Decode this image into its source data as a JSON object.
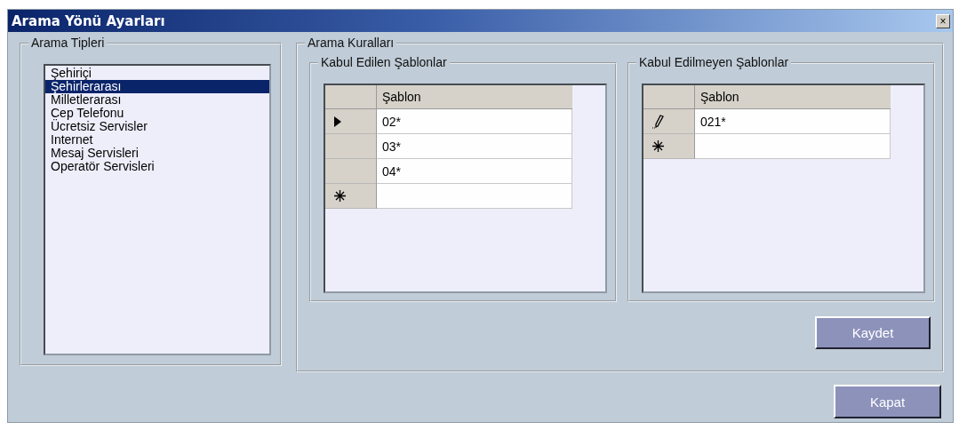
{
  "window": {
    "title": "Arama Yönü Ayarları",
    "close": "×"
  },
  "call_types": {
    "title": "Arama Tipleri",
    "items": [
      {
        "label": "Şehiriçi",
        "selected": false
      },
      {
        "label": "Şehirlerarası",
        "selected": true
      },
      {
        "label": "Milletlerarası",
        "selected": false
      },
      {
        "label": "Cep Telefonu",
        "selected": false
      },
      {
        "label": "Ücretsiz Servisler",
        "selected": false
      },
      {
        "label": "Internet",
        "selected": false
      },
      {
        "label": "Mesaj Servisleri",
        "selected": false
      },
      {
        "label": "Operatör Servisleri",
        "selected": false
      }
    ]
  },
  "call_rules": {
    "title": "Arama Kuralları",
    "grids": [
      {
        "title": "Kabul Edilen Şablonlar",
        "columns": [
          "Şablon"
        ],
        "rows": [
          {
            "kind": "current",
            "value": "02*"
          },
          {
            "kind": "plain",
            "value": "03*"
          },
          {
            "kind": "plain",
            "value": "04*"
          },
          {
            "kind": "new"
          }
        ]
      },
      {
        "title": "Kabul Edilmeyen Şablonlar",
        "columns": [
          "Şablon"
        ],
        "rows": [
          {
            "kind": "editing",
            "value": "021*"
          },
          {
            "kind": "new"
          }
        ]
      }
    ],
    "save_button": "Kaydet"
  },
  "close_button": "Kapat"
}
